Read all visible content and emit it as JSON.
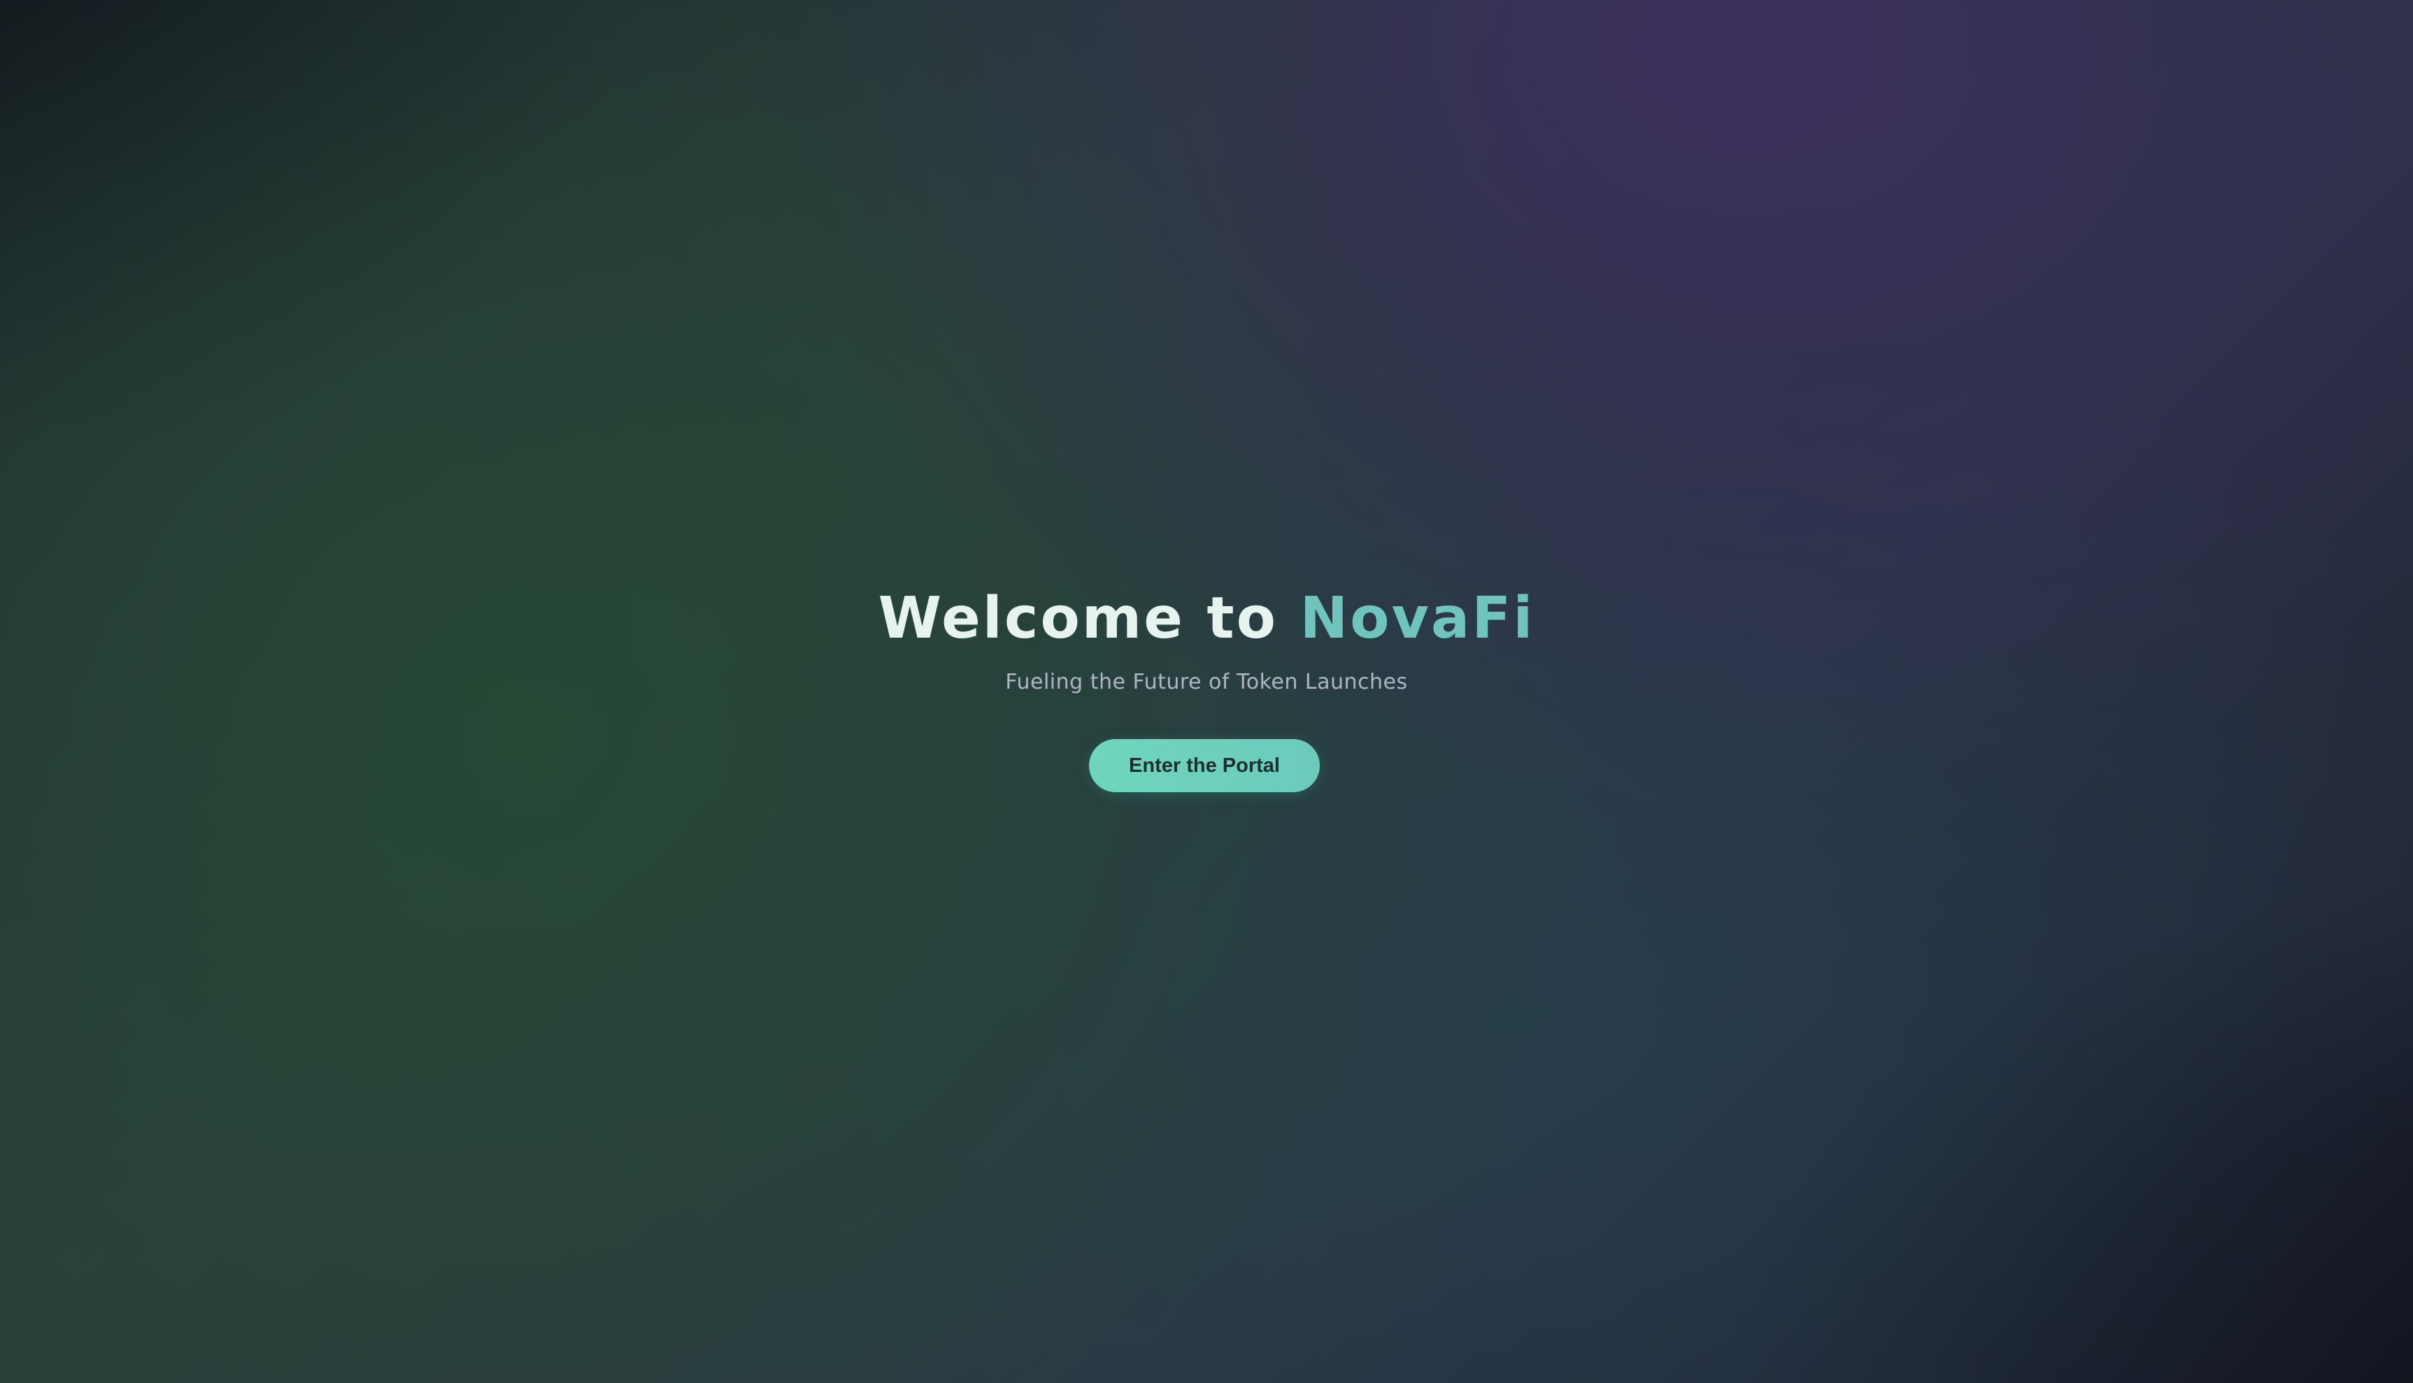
{
  "hero": {
    "title_prefix": "Welcome to ",
    "title_brand": "NovaFi",
    "subtitle": "Fueling the Future of Token Launches",
    "cta_label": "Enter the Portal"
  },
  "colors": {
    "brand_accent": "#6fc4bd",
    "title_text": "#e6f3ee",
    "subtitle_text": "#aeb6c4",
    "button_background": "#6fd6bb",
    "button_text": "#1d2e2e"
  }
}
